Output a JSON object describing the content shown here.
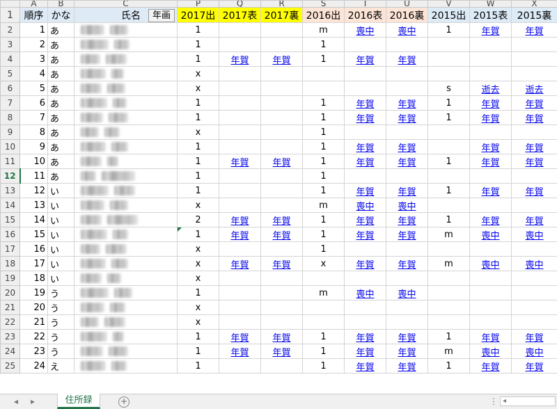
{
  "column_letters": [
    "A",
    "B",
    "C",
    "P",
    "Q",
    "R",
    "S",
    "T",
    "U",
    "V",
    "W",
    "X"
  ],
  "header_row": {
    "row_num": "1",
    "cells": [
      "順序",
      "かな",
      "氏名",
      "2017出",
      "2017表",
      "2017裏",
      "2016出",
      "2016表",
      "2016裏",
      "2015出",
      "2015表",
      "2015裏"
    ],
    "nenga_button": "年画"
  },
  "rows": [
    {
      "r": "2",
      "seq": "1",
      "kana": "あ",
      "p": "1",
      "q": "",
      "r2": "",
      "s": "m",
      "t": "喪中",
      "u": "喪中",
      "v": "1",
      "w": "年賀",
      "x": "年賀"
    },
    {
      "r": "3",
      "seq": "2",
      "kana": "あ",
      "p": "1",
      "q": "",
      "r2": "",
      "s": "1",
      "t": "",
      "u": "",
      "v": "",
      "w": "",
      "x": ""
    },
    {
      "r": "4",
      "seq": "3",
      "kana": "あ",
      "p": "1",
      "q": "年賀",
      "r2": "年賀",
      "s": "1",
      "t": "年賀",
      "u": "年賀",
      "v": "",
      "w": "",
      "x": ""
    },
    {
      "r": "5",
      "seq": "4",
      "kana": "あ",
      "p": "x",
      "q": "",
      "r2": "",
      "s": "",
      "t": "",
      "u": "",
      "v": "",
      "w": "",
      "x": ""
    },
    {
      "r": "6",
      "seq": "5",
      "kana": "あ",
      "p": "x",
      "q": "",
      "r2": "",
      "s": "",
      "t": "",
      "u": "",
      "v": "s",
      "w": "逝去",
      "x": "逝去"
    },
    {
      "r": "7",
      "seq": "6",
      "kana": "あ",
      "p": "1",
      "q": "",
      "r2": "",
      "s": "1",
      "t": "年賀",
      "u": "年賀",
      "v": "1",
      "w": "年賀",
      "x": "年賀"
    },
    {
      "r": "8",
      "seq": "7",
      "kana": "あ",
      "p": "1",
      "q": "",
      "r2": "",
      "s": "1",
      "t": "年賀",
      "u": "年賀",
      "v": "1",
      "w": "年賀",
      "x": "年賀"
    },
    {
      "r": "9",
      "seq": "8",
      "kana": "あ",
      "p": "x",
      "q": "",
      "r2": "",
      "s": "1",
      "t": "",
      "u": "",
      "v": "",
      "w": "",
      "x": ""
    },
    {
      "r": "10",
      "seq": "9",
      "kana": "あ",
      "p": "1",
      "q": "",
      "r2": "",
      "s": "1",
      "t": "年賀",
      "u": "年賀",
      "v": "",
      "w": "年賀",
      "x": "年賀"
    },
    {
      "r": "11",
      "seq": "10",
      "kana": "あ",
      "p": "1",
      "q": "年賀",
      "r2": "年賀",
      "s": "1",
      "t": "年賀",
      "u": "年賀",
      "v": "1",
      "w": "年賀",
      "x": "年賀"
    },
    {
      "r": "12",
      "seq": "11",
      "kana": "あ",
      "p": "1",
      "q": "",
      "r2": "",
      "s": "1",
      "t": "",
      "u": "",
      "v": "",
      "w": "",
      "x": ""
    },
    {
      "r": "13",
      "seq": "12",
      "kana": "い",
      "p": "1",
      "q": "",
      "r2": "",
      "s": "1",
      "t": "年賀",
      "u": "年賀",
      "v": "1",
      "w": "年賀",
      "x": "年賀"
    },
    {
      "r": "14",
      "seq": "13",
      "kana": "い",
      "p": "x",
      "q": "",
      "r2": "",
      "s": "m",
      "t": "喪中",
      "u": "喪中",
      "v": "",
      "w": "",
      "x": ""
    },
    {
      "r": "15",
      "seq": "14",
      "kana": "い",
      "p": "2",
      "q": "年賀",
      "r2": "年賀",
      "s": "1",
      "t": "年賀",
      "u": "年賀",
      "v": "1",
      "w": "年賀",
      "x": "年賀"
    },
    {
      "r": "16",
      "seq": "15",
      "kana": "い",
      "p": "1",
      "q": "年賀",
      "r2": "年賀",
      "s": "1",
      "t": "年賀",
      "u": "年賀",
      "v": "m",
      "w": "喪中",
      "x": "喪中"
    },
    {
      "r": "17",
      "seq": "16",
      "kana": "い",
      "p": "x",
      "q": "",
      "r2": "",
      "s": "1",
      "t": "",
      "u": "",
      "v": "",
      "w": "",
      "x": ""
    },
    {
      "r": "18",
      "seq": "17",
      "kana": "い",
      "p": "x",
      "q": "年賀",
      "r2": "年賀",
      "s": "x",
      "t": "年賀",
      "u": "年賀",
      "v": "m",
      "w": "喪中",
      "x": "喪中"
    },
    {
      "r": "19",
      "seq": "18",
      "kana": "い",
      "p": "x",
      "q": "",
      "r2": "",
      "s": "",
      "t": "",
      "u": "",
      "v": "",
      "w": "",
      "x": ""
    },
    {
      "r": "20",
      "seq": "19",
      "kana": "う",
      "p": "1",
      "q": "",
      "r2": "",
      "s": "m",
      "t": "喪中",
      "u": "喪中",
      "v": "",
      "w": "",
      "x": ""
    },
    {
      "r": "21",
      "seq": "20",
      "kana": "う",
      "p": "x",
      "q": "",
      "r2": "",
      "s": "",
      "t": "",
      "u": "",
      "v": "",
      "w": "",
      "x": ""
    },
    {
      "r": "22",
      "seq": "21",
      "kana": "う",
      "p": "x",
      "q": "",
      "r2": "",
      "s": "",
      "t": "",
      "u": "",
      "v": "",
      "w": "",
      "x": ""
    },
    {
      "r": "23",
      "seq": "22",
      "kana": "う",
      "p": "1",
      "q": "年賀",
      "r2": "年賀",
      "s": "1",
      "t": "年賀",
      "u": "年賀",
      "v": "1",
      "w": "年賀",
      "x": "年賀"
    },
    {
      "r": "24",
      "seq": "23",
      "kana": "う",
      "p": "1",
      "q": "年賀",
      "r2": "年賀",
      "s": "1",
      "t": "年賀",
      "u": "年賀",
      "v": "m",
      "w": "喪中",
      "x": "喪中"
    },
    {
      "r": "25",
      "seq": "24",
      "kana": "え",
      "p": "1",
      "q": "",
      "r2": "",
      "s": "1",
      "t": "年賀",
      "u": "年賀",
      "v": "1",
      "w": "年賀",
      "x": "年賀"
    }
  ],
  "active_row": "12",
  "sheet_tab": "住所録",
  "add_sheet_symbol": "+",
  "nav_prev": "◂",
  "nav_next": "▸",
  "more_symbol": "⋮",
  "scroll_left": "◂",
  "icons": {
    "add_sheet": "plus-circle-icon"
  },
  "colors": {
    "header_yellow": "#ffff00",
    "header_peach": "#fce4d6",
    "header_blue": "#ddebf7",
    "link": "#0000ee",
    "accent": "#217346"
  }
}
